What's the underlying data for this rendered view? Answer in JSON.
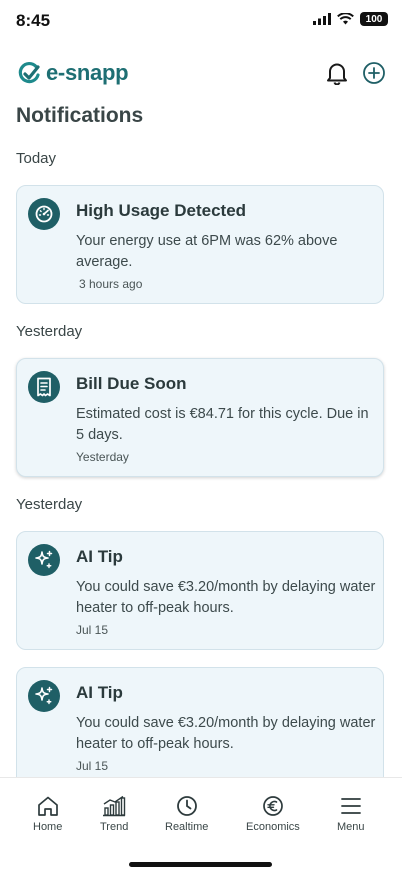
{
  "status_bar": {
    "time": "8:45",
    "battery": "100"
  },
  "header": {
    "logo_text": "e-snapp"
  },
  "page": {
    "title": "Notifications"
  },
  "sections": [
    {
      "label": "Today"
    },
    {
      "label": "Yesterday"
    },
    {
      "label": "Yesterday"
    }
  ],
  "notifications": [
    {
      "icon": "gauge-icon",
      "title": "High Usage Detected",
      "body": "Your energy use at 6PM was 62% above average.",
      "time": "3 hours ago"
    },
    {
      "icon": "receipt-icon",
      "title": "Bill Due Soon",
      "body": "Estimated cost is €84.71 for this cycle. Due in 5 days.",
      "time": "Yesterday"
    },
    {
      "icon": "sparkle-icon",
      "title": "AI Tip",
      "body": "You could save €3.20/month by delaying water heater to off-peak hours.",
      "time": "Jul 15"
    },
    {
      "icon": "sparkle-icon",
      "title": "AI Tip",
      "body": "You could save €3.20/month by delaying water heater to off-peak hours.",
      "time": "Jul 15"
    }
  ],
  "bottom_nav": [
    {
      "label": "Home",
      "icon": "home-icon"
    },
    {
      "label": "Trend",
      "icon": "bar-chart-icon"
    },
    {
      "label": "Realtime",
      "icon": "clock-icon"
    },
    {
      "label": "Economics",
      "icon": "euro-icon"
    },
    {
      "label": "Menu",
      "icon": "hamburger-menu-icon"
    }
  ],
  "colors": {
    "accent": "#1f5f66",
    "card_bg": "#eef6fa",
    "card_border": "#d2e2ea"
  }
}
